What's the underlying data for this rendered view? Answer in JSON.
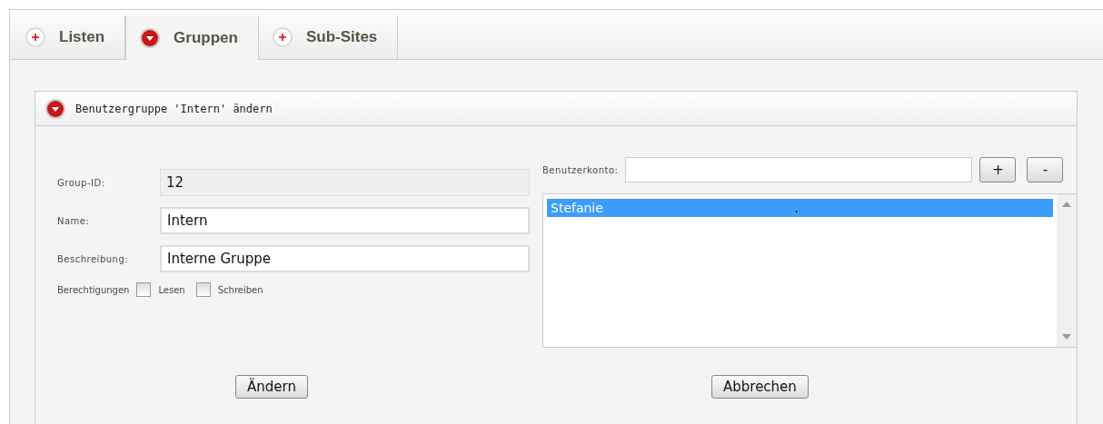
{
  "tabs": [
    {
      "label": "Listen",
      "selected": false
    },
    {
      "label": "Gruppen",
      "selected": true
    },
    {
      "label": "Sub-Sites",
      "selected": false
    }
  ],
  "panel": {
    "title": "Benutzergruppe 'Intern' ändern",
    "form": {
      "fields": [
        {
          "label": "Group-ID:",
          "value": "12",
          "disabled": true
        },
        {
          "label": "Name:",
          "value": "Intern",
          "disabled": false
        },
        {
          "label": "Beschreibung:",
          "value": "Interne Gruppe",
          "disabled": false
        }
      ],
      "permissions": {
        "label": "Berechtigungen",
        "options": [
          {
            "label": "Lesen",
            "checked": false
          },
          {
            "label": "Schreiben",
            "checked": false
          }
        ]
      }
    },
    "account": {
      "label": "Benutzerkonto:",
      "add_button": "+",
      "remove_button": "-",
      "users": [
        {
          "name": "Stefanie",
          "suffix": ".",
          "selected": true
        }
      ]
    },
    "buttons": [
      "Ändern",
      "Abbrechen"
    ]
  }
}
